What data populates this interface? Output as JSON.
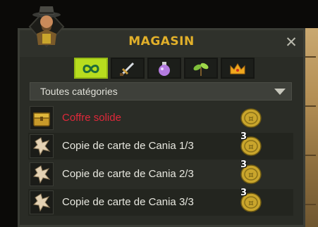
{
  "window": {
    "title": "MAGASIN",
    "close_label": "✕"
  },
  "tabs": [
    {
      "icon": "infinity-icon",
      "active": true
    },
    {
      "icon": "sword-icon",
      "active": false
    },
    {
      "icon": "potion-icon",
      "active": false
    },
    {
      "icon": "plant-icon",
      "active": false
    },
    {
      "icon": "crown-icon",
      "active": false
    }
  ],
  "filter": {
    "selected": "Toutes catégories"
  },
  "items": [
    {
      "name": "Coffre solide",
      "icon": "chest-icon",
      "highlight": true,
      "quantity": ""
    },
    {
      "name": "Copie de carte de Cania 1/3",
      "icon": "map-fragment-icon",
      "highlight": false,
      "quantity": "3"
    },
    {
      "name": "Copie de carte de Cania 2/3",
      "icon": "map-fragment-icon",
      "highlight": false,
      "quantity": "3"
    },
    {
      "name": "Copie de carte de Cania 3/3",
      "icon": "map-fragment-icon",
      "highlight": false,
      "quantity": "3"
    }
  ],
  "colors": {
    "title": "#e2b02a",
    "highlight_item": "#e0283a",
    "active_tab": "#b7dd1e",
    "coin": "#c9a52c"
  }
}
